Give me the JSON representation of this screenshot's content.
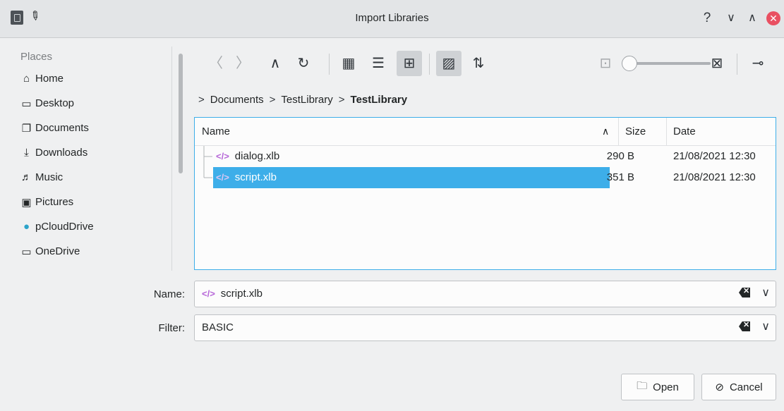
{
  "window": {
    "title": "Import Libraries",
    "help": "?",
    "minimize": "∨",
    "maximize": "∧",
    "close": "✕"
  },
  "sidebar": {
    "heading": "Places",
    "items": [
      {
        "label": "Home",
        "icon": "⌂"
      },
      {
        "label": "Desktop",
        "icon": "▭"
      },
      {
        "label": "Documents",
        "icon": "❐"
      },
      {
        "label": "Downloads",
        "icon": "⤓"
      },
      {
        "label": "Music",
        "icon": "♬"
      },
      {
        "label": "Pictures",
        "icon": "▣"
      },
      {
        "label": "pCloudDrive",
        "icon": "●"
      },
      {
        "label": "OneDrive",
        "icon": "▭"
      }
    ]
  },
  "toolbar": {
    "back": "〈",
    "forward": "〉",
    "up": "∧",
    "reload": "↻",
    "icons_view": "▦",
    "details_view": "☰",
    "tree_view": "⊞",
    "preview": "▨",
    "sort": "⇅",
    "zoom_out": "⊡",
    "zoom_in": "⊠",
    "options": "⊸"
  },
  "breadcrumb": {
    "sep": ">",
    "items": [
      "Documents",
      "TestLibrary",
      "TestLibrary"
    ]
  },
  "filelist": {
    "columns": {
      "name": "Name",
      "size": "Size",
      "date": "Date"
    },
    "sort_indicator": "∧",
    "rows": [
      {
        "name": "dialog.xlb",
        "size": "290 B",
        "date": "21/08/2021 12:30",
        "selected": false
      },
      {
        "name": "script.xlb",
        "size": "351 B",
        "date": "21/08/2021 12:30",
        "selected": true
      }
    ]
  },
  "name_field": {
    "label": "Name:",
    "value": "script.xlb"
  },
  "filter_field": {
    "label": "Filter:",
    "value": "BASIC"
  },
  "buttons": {
    "open": "Open",
    "cancel": "Cancel"
  },
  "colors": {
    "accent": "#3daee9",
    "close": "#e95062",
    "xml_icon": "#b666d8"
  }
}
